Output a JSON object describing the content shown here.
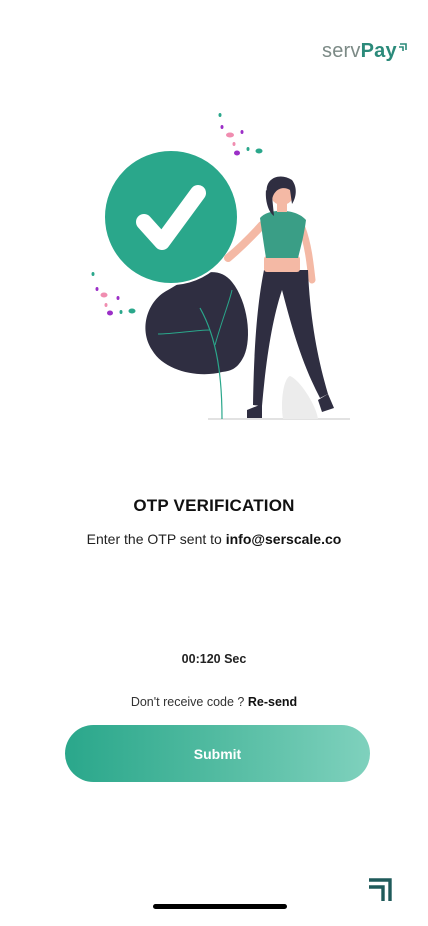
{
  "brand": {
    "logo_serv": "serv",
    "logo_pay": "Pay",
    "accent_color": "#2aa78b",
    "dark_teal": "#1f5a5a"
  },
  "illustration": {
    "icon": "checkmark-icon",
    "description_name": "woman-with-checkmark-illustration"
  },
  "verification": {
    "title": "OTP VERIFICATION",
    "subtitle_prefix": "Enter the OTP sent to",
    "email": "info@serscale.co"
  },
  "timer": {
    "text": "00:120 Sec"
  },
  "resend": {
    "prompt": "Don't receive code ?",
    "link_label": "Re-send"
  },
  "submit": {
    "label": "Submit"
  },
  "footer": {
    "icon": "corner-arrow-icon"
  }
}
